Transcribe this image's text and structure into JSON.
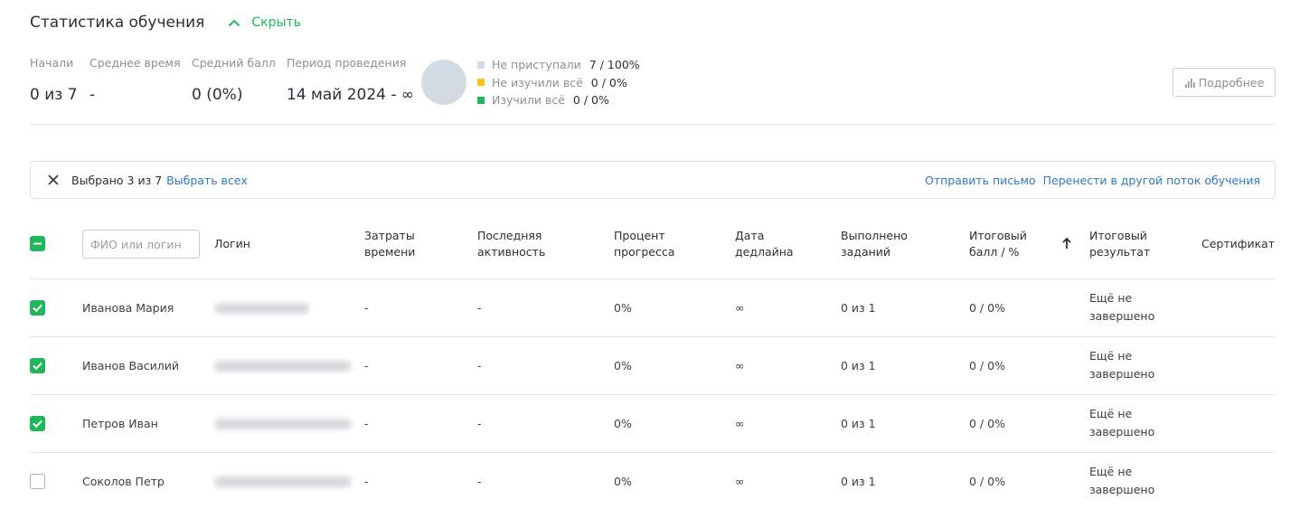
{
  "header": {
    "title": "Статистика обучения",
    "toggle_label": "Скрыть"
  },
  "stats": [
    {
      "label": "Начали",
      "value": "0 из 7"
    },
    {
      "label": "Среднее время",
      "value": "-"
    },
    {
      "label": "Средний балл",
      "value": "0 (0%)"
    },
    {
      "label": "Период проведения",
      "value": "14 май 2024 - ∞"
    }
  ],
  "legend": [
    {
      "label": "Не приступали",
      "value": "7 / 100%",
      "color": "#d3dbe5"
    },
    {
      "label": "Не изучили всё",
      "value": "0 / 0%",
      "color": "#f5c518"
    },
    {
      "label": "Изучили всё",
      "value": "0 / 0%",
      "color": "#1fb85a"
    }
  ],
  "details_button": "Подробнее",
  "selection": {
    "count_text": "Выбрано 3 из 7",
    "select_all": "Выбрать всех",
    "send_letter": "Отправить письмо",
    "move_stream": "Перенести в другой поток обучения"
  },
  "table": {
    "search_placeholder": "ФИО или логин",
    "columns": {
      "login": "Логин",
      "time": "Затраты времени",
      "activity": "Последняя активность",
      "progress": "Процент прогресса",
      "deadline": "Дата дедлайна",
      "tasks": "Выполнено заданий",
      "score": "Итоговый балл / %",
      "result": "Итоговый результат",
      "certificate": "Сертификат"
    },
    "rows": [
      {
        "checked": true,
        "name": "Иванова Мария",
        "time": "-",
        "activity": "-",
        "progress": "0%",
        "deadline": "∞",
        "tasks": "0 из 1",
        "score": "0 / 0%",
        "result": "Ещё не завершено"
      },
      {
        "checked": true,
        "name": "Иванов Василий",
        "time": "-",
        "activity": "-",
        "progress": "0%",
        "deadline": "∞",
        "tasks": "0 из 1",
        "score": "0 / 0%",
        "result": "Ещё не завершено"
      },
      {
        "checked": true,
        "name": "Петров Иван",
        "time": "-",
        "activity": "-",
        "progress": "0%",
        "deadline": "∞",
        "tasks": "0 из 1",
        "score": "0 / 0%",
        "result": "Ещё не завершено"
      },
      {
        "checked": false,
        "name": "Соколов Петр",
        "time": "-",
        "activity": "-",
        "progress": "0%",
        "deadline": "∞",
        "tasks": "0 из 1",
        "score": "0 / 0%",
        "result": "Ещё не завершено"
      }
    ]
  },
  "colors": {
    "accent": "#1fb85a",
    "link": "#2f78c4"
  },
  "icons": {
    "toggle": "chevron-up-icon",
    "details": "bar-chart-icon",
    "close": "close-icon",
    "sort": "arrow-up-icon"
  }
}
